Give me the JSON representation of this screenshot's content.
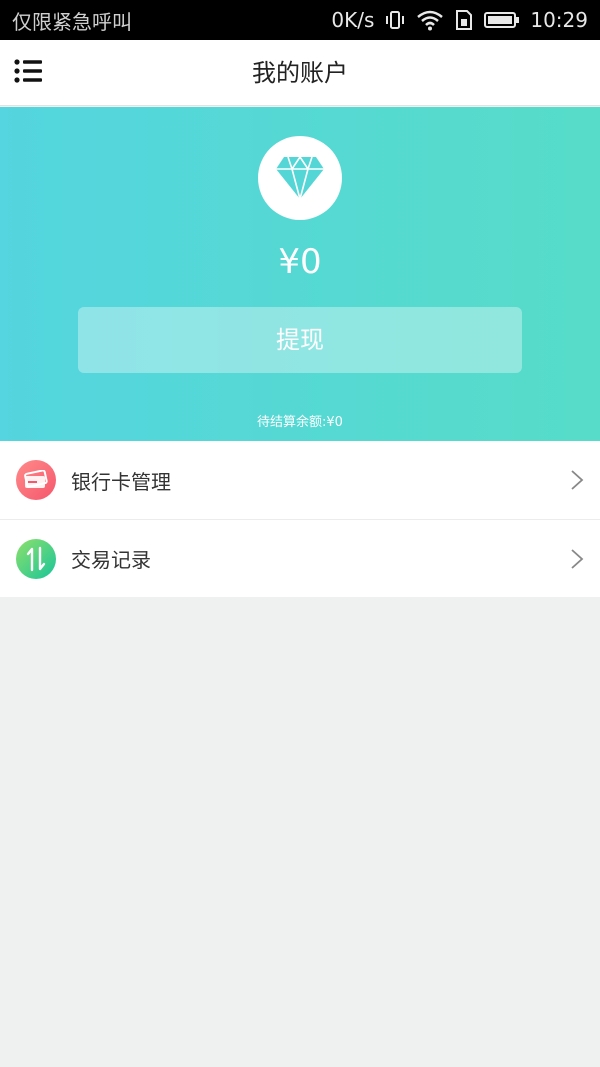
{
  "status_bar": {
    "carrier_text": "仅限紧急呼叫",
    "net_speed": "0K/s",
    "time": "10:29"
  },
  "header": {
    "title": "我的账户",
    "menu_icon": "menu-list-icon"
  },
  "account": {
    "icon": "diamond-icon",
    "balance": "¥0",
    "withdraw_label": "提现",
    "pending_text": "待结算余额:¥0"
  },
  "menu": {
    "items": [
      {
        "label": "银行卡管理",
        "icon": "bank-card-icon",
        "color": "#f5576c"
      },
      {
        "label": "交易记录",
        "icon": "transaction-arrows-icon",
        "color": "#18c59a"
      }
    ]
  },
  "colors": {
    "hero_gradient_start": "#54d5df",
    "hero_gradient_end": "#56dcc8",
    "background": "#eff0f0"
  }
}
